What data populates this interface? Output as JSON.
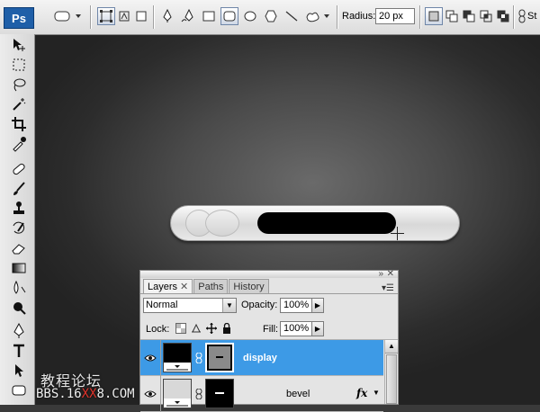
{
  "app": {
    "logo": "Ps"
  },
  "options_bar": {
    "radius_label": "Radius:",
    "radius_value": "20 px",
    "style_label": "St",
    "tools": [
      "shape-layers-icon",
      "paths-icon",
      "fill-pixels-icon",
      "pen-icon",
      "freeform-pen-icon",
      "rectangle-icon",
      "rounded-rectangle-icon",
      "ellipse-icon",
      "polygon-icon",
      "line-icon",
      "custom-shape-icon"
    ],
    "selected_tool": "rounded-rectangle-icon"
  },
  "toolbox": {
    "tools": [
      "move-icon",
      "marquee-icon",
      "lasso-icon",
      "magic-wand-icon",
      "crop-icon",
      "eyedropper-icon",
      "healing-brush-icon",
      "brush-icon",
      "clone-stamp-icon",
      "history-brush-icon",
      "eraser-icon",
      "gradient-icon",
      "blur-icon",
      "dodge-icon",
      "pen-icon",
      "type-icon",
      "path-selection-icon"
    ]
  },
  "layers_panel": {
    "tabs": [
      {
        "label": "Layers",
        "active": true
      },
      {
        "label": "Paths",
        "active": false
      },
      {
        "label": "History",
        "active": false
      }
    ],
    "blend_mode": "Normal",
    "opacity_label": "Opacity:",
    "opacity_value": "100%",
    "lock_label": "Lock:",
    "fill_label": "Fill:",
    "fill_value": "100%",
    "layers": [
      {
        "name": "display",
        "selected": true,
        "visible": true,
        "fx": false
      },
      {
        "name": "bevel",
        "selected": false,
        "visible": true,
        "fx": true,
        "fx_label": "fx"
      }
    ]
  },
  "watermark": {
    "chinese": "教程论坛",
    "url_part1": "BBS.16",
    "url_red": "XX",
    "url_part2": "8.COM"
  },
  "colors": {
    "selection": "#3d9ae6",
    "ps_blue": "#1f5fa8",
    "watermark_red": "#e0342c"
  }
}
